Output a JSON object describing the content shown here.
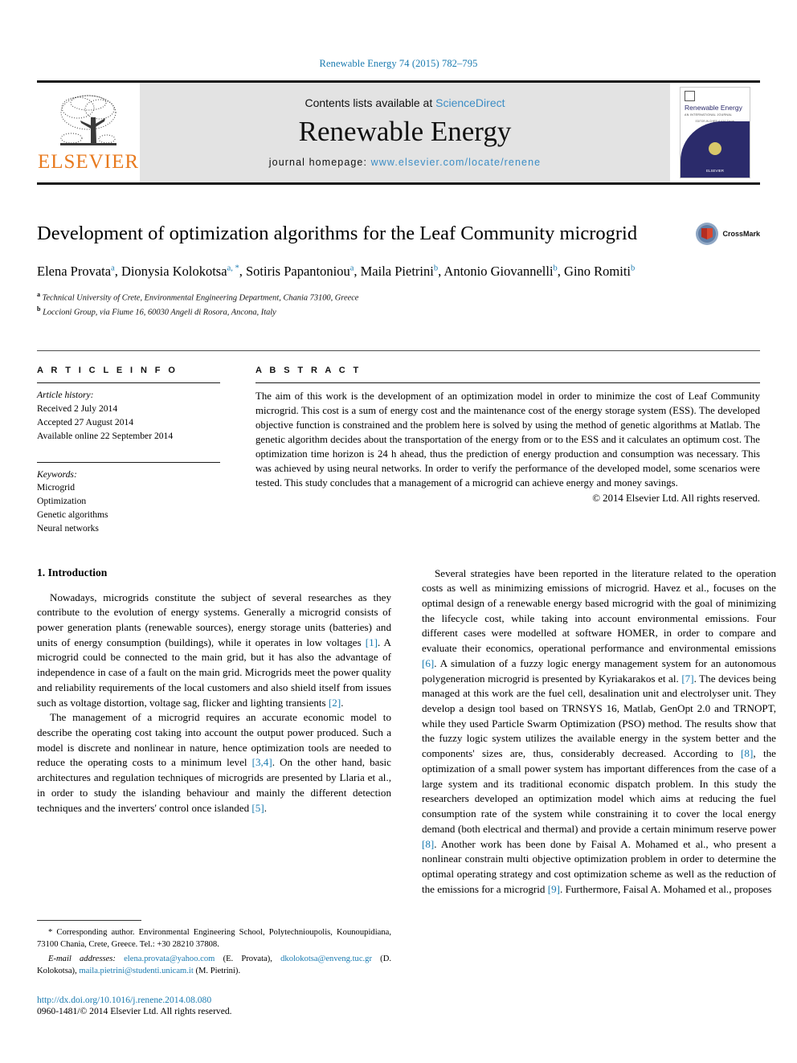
{
  "running_head": "Renewable Energy 74 (2015) 782–795",
  "masthead": {
    "publisher_logo_text": "ELSEVIER",
    "contents_prefix": "Contents lists available at ",
    "contents_link": "ScienceDirect",
    "journal_title": "Renewable Energy",
    "homepage_prefix": "journal homepage: ",
    "homepage_url": "www.elsevier.com/locate/renene",
    "cover": {
      "title": "Renewable Energy",
      "subtitle": "AN INTERNATIONAL JOURNAL",
      "line3": "EDITOR-IN-CHIEF: A.A.M. Sayigh",
      "footer": "ELSEVIER"
    }
  },
  "article": {
    "title": "Development of optimization algorithms for the Leaf Community microgrid",
    "crossmark_label": "CrossMark",
    "authors": [
      {
        "name": "Elena Provata",
        "marks": "a"
      },
      {
        "name": "Dionysia Kolokotsa",
        "marks": "a, *"
      },
      {
        "name": "Sotiris Papantoniou",
        "marks": "a"
      },
      {
        "name": "Maila Pietrini",
        "marks": "b"
      },
      {
        "name": "Antonio Giovannelli",
        "marks": "b"
      },
      {
        "name": "Gino Romiti",
        "marks": "b"
      }
    ],
    "affiliations": [
      {
        "mark": "a",
        "text": "Technical University of Crete, Environmental Engineering Department, Chania 73100, Greece"
      },
      {
        "mark": "b",
        "text": "Loccioni Group, via Fiume 16, 60030 Angeli di Rosora, Ancona, Italy"
      }
    ]
  },
  "article_info": {
    "heading": "A R T I C L E   I N F O",
    "history_label": "Article history:",
    "history": [
      "Received 2 July 2014",
      "Accepted 27 August 2014",
      "Available online 22 September 2014"
    ],
    "keywords_label": "Keywords:",
    "keywords": [
      "Microgrid",
      "Optimization",
      "Genetic algorithms",
      "Neural networks"
    ]
  },
  "abstract": {
    "heading": "A B S T R A C T",
    "text": "The aim of this work is the development of an optimization model in order to minimize the cost of Leaf Community microgrid. This cost is a sum of energy cost and the maintenance cost of the energy storage system (ESS). The developed objective function is constrained and the problem here is solved by using the method of genetic algorithms at Matlab. The genetic algorithm decides about the transportation of the energy from or to the ESS and it calculates an optimum cost. The optimization time horizon is 24 h ahead, thus the prediction of energy production and consumption was necessary. This was achieved by using neural networks. In order to verify the performance of the developed model, some scenarios were tested. This study concludes that a management of a microgrid can achieve energy and money savings.",
    "copyright": "© 2014 Elsevier Ltd. All rights reserved."
  },
  "introduction": {
    "heading": "1. Introduction",
    "left_paragraphs": [
      "Nowadays, microgrids constitute the subject of several researches as they contribute to the evolution of energy systems. Generally a microgrid consists of power generation plants (renewable sources), energy storage units (batteries) and units of energy consumption (buildings), while it operates in low voltages [1]. A microgrid could be connected to the main grid, but it has also the advantage of independence in case of a fault on the main grid. Microgrids meet the power quality and reliability requirements of the local customers and also shield itself from issues such as voltage distortion, voltage sag, flicker and lighting transients [2].",
      "The management of a microgrid requires an accurate economic model to describe the operating cost taking into account the output power produced. Such a model is discrete and nonlinear in nature, hence optimization tools are needed to reduce the operating costs to a minimum level [3,4]. On the other hand, basic architectures and regulation techniques of microgrids are presented by Llaria et al., in order to study the islanding behaviour and mainly the different detection techniques and the inverters' control once islanded [5]."
    ],
    "right_paragraphs": [
      "Several strategies have been reported in the literature related to the operation costs as well as minimizing emissions of microgrid. Havez et al., focuses on the optimal design of a renewable energy based microgrid with the goal of minimizing the lifecycle cost, while taking into account environmental emissions. Four different cases were modelled at software HOMER, in order to compare and evaluate their economics, operational performance and environmental emissions [6]. A simulation of a fuzzy logic energy management system for an autonomous polygeneration microgrid is presented by Kyriakarakos et al. [7]. The devices being managed at this work are the fuel cell, desalination unit and electrolyser unit. They develop a design tool based on TRNSYS 16, Matlab, GenOpt 2.0 and TRNOPT, while they used Particle Swarm Optimization (PSO) method. The results show that the fuzzy logic system utilizes the available energy in the system better and the components' sizes are, thus, considerably decreased. According to [8], the optimization of a small power system has important differences from the case of a large system and its traditional economic dispatch problem. In this study the researchers developed an optimization model which aims at reducing the fuel consumption rate of the system while constraining it to cover the local energy demand (both electrical and thermal) and provide a certain minimum reserve power [8]. Another work has been done by Faisal A. Mohamed et al., who present a nonlinear constrain multi objective optimization problem in order to determine the optimal operating strategy and cost optimization scheme as well as the reduction of the emissions for a microgrid [9]. Furthermore, Faisal A. Mohamed et al., proposes"
    ]
  },
  "footnotes": {
    "corresponding": "* Corresponding author. Environmental Engineering School, Polytechnioupolis, Kounoupidiana, 73100 Chania, Crete, Greece. Tel.: +30 28210 37808.",
    "email_label": "E-mail addresses:",
    "emails": [
      {
        "address": "elena.provata@yahoo.com",
        "person": "(E. Provata)"
      },
      {
        "address": "dkolokotsa@enveng.tuc.gr",
        "person": "(D. Kolokotsa)"
      },
      {
        "address": "maila.pietrini@studenti.unicam.it",
        "person": "(M. Pietrini)"
      }
    ],
    "doi": "http://dx.doi.org/10.1016/j.renene.2014.08.080",
    "issn_line": "0960-1481/© 2014 Elsevier Ltd. All rights reserved."
  },
  "colors": {
    "link": "#1b7bb0",
    "sciencedirect": "#3c8dc5",
    "elsevier_orange": "#e87a1e",
    "masthead_bg": "#e3e3e3",
    "cover_navy": "#2b2b6b"
  }
}
